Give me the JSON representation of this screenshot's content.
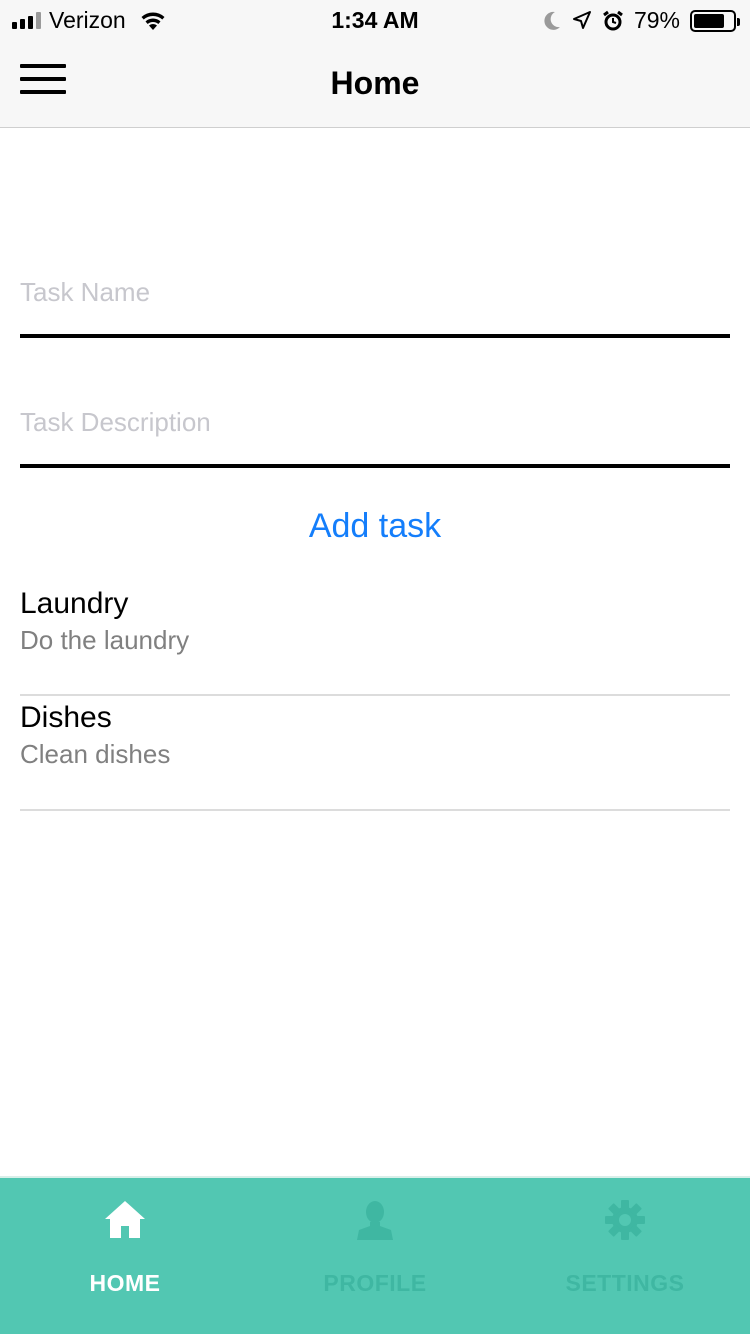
{
  "status_bar": {
    "carrier": "Verizon",
    "time": "1:34 AM",
    "battery": "79%",
    "battery_level": 0.79,
    "icons": [
      "signal-icon",
      "wifi-icon",
      "moon-icon",
      "location-arrow-icon",
      "alarm-icon",
      "battery-icon"
    ]
  },
  "header": {
    "title": "Home",
    "menu_icon": "hamburger-menu-icon"
  },
  "form": {
    "task_name_placeholder": "Task Name",
    "task_name_value": "",
    "task_description_placeholder": "Task Description",
    "task_description_value": "",
    "add_task_label": "Add task",
    "accent_color": "#147efb"
  },
  "tasks": [
    {
      "title": "Laundry",
      "description": "Do the laundry"
    },
    {
      "title": "Dishes",
      "description": "Clean dishes"
    }
  ],
  "tab_bar": {
    "background_color": "#52c7b2",
    "tabs": [
      {
        "label": "HOME",
        "icon": "home-icon",
        "active": true
      },
      {
        "label": "PROFILE",
        "icon": "user-icon",
        "active": false
      },
      {
        "label": "SETTINGS",
        "icon": "gear-icon",
        "active": false
      }
    ]
  }
}
